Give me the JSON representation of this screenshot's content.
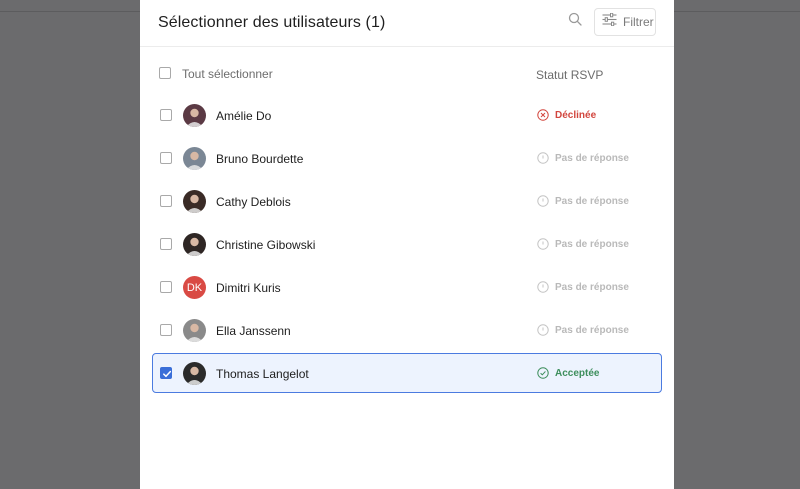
{
  "modal": {
    "title": "Sélectionner des utilisateurs (1)",
    "filter_label": "Filtrer"
  },
  "list": {
    "select_all_label": "Tout sélectionner",
    "rsvp_header": "Statut RSVP"
  },
  "users": [
    {
      "name": "Amélie Do",
      "status": "Déclinée",
      "status_type": "declined",
      "checked": false,
      "avatar_color": "#5b3a44"
    },
    {
      "name": "Bruno Bourdette",
      "status": "Pas de réponse",
      "status_type": "pending",
      "checked": false,
      "avatar_color": "#7b8795"
    },
    {
      "name": "Cathy Deblois",
      "status": "Pas de réponse",
      "status_type": "pending",
      "checked": false,
      "avatar_color": "#3a2b26"
    },
    {
      "name": "Christine Gibowski",
      "status": "Pas de réponse",
      "status_type": "pending",
      "checked": false,
      "avatar_color": "#2e2624"
    },
    {
      "name": "Dimitri Kuris",
      "status": "Pas de réponse",
      "status_type": "pending",
      "checked": false,
      "avatar_initials": "DK",
      "avatar_color": "#d94a44"
    },
    {
      "name": "Ella Janssenn",
      "status": "Pas de réponse",
      "status_type": "pending",
      "checked": false,
      "avatar_color": "#8a8a8a"
    },
    {
      "name": "Thomas Langelot",
      "status": "Acceptée",
      "status_type": "accepted",
      "checked": true,
      "avatar_color": "#2b2b2b"
    }
  ],
  "colors": {
    "accent": "#3a6ed8",
    "declined": "#d2463e",
    "pending": "#b9b9b9",
    "accepted": "#3d8e5c",
    "selected_row_bg": "#edf3fe"
  }
}
